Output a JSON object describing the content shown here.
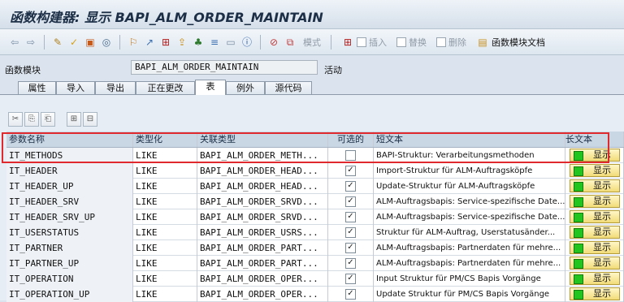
{
  "window": {
    "title": "函数构建器: 显示 BAPI_ALM_ORDER_MAINTAIN"
  },
  "toolbar": {
    "icons": [
      "back-icon",
      "forward-icon",
      "edit-toggle-icon",
      "check-icon",
      "activate-icon",
      "test-icon",
      "where-used-icon",
      "pattern-icon",
      "hierarchy-icon",
      "other-object-icon",
      "display-object-list-icon",
      "navigate-icon",
      "window-icon",
      "info-icon",
      "stop-icon",
      "copy-icon"
    ],
    "mode_label": "模式",
    "insert_label": "插入",
    "replace_label": "替换",
    "delete_label": "删除",
    "docs_label": "函数模块文档"
  },
  "form": {
    "module_label": "函数模块",
    "module_value": "BAPI_ALM_ORDER_MAINTAIN",
    "status": "活动"
  },
  "tabs": [
    "属性",
    "导入",
    "导出",
    "正在更改",
    "表",
    "例外",
    "源代码"
  ],
  "active_tab": "表",
  "grid": {
    "headers": {
      "param": "参数名称",
      "type": "类型化",
      "ref": "关联类型",
      "optional": "可选的",
      "short_text": "短文本",
      "long_text": "长文本"
    },
    "show_label": "显示",
    "rows": [
      {
        "param": "IT_METHODS",
        "type": "LIKE",
        "ref": "BAPI_ALM_ORDER_METH...",
        "optional": false,
        "short_text": "BAPI-Struktur: Verarbeitungsmethoden"
      },
      {
        "param": "IT_HEADER",
        "type": "LIKE",
        "ref": "BAPI_ALM_ORDER_HEAD...",
        "optional": true,
        "short_text": "Import-Struktur für ALM-Auftragsköpfe"
      },
      {
        "param": "IT_HEADER_UP",
        "type": "LIKE",
        "ref": "BAPI_ALM_ORDER_HEAD...",
        "optional": true,
        "short_text": "Update-Struktur für ALM-Auftragsköpfe"
      },
      {
        "param": "IT_HEADER_SRV",
        "type": "LIKE",
        "ref": "BAPI_ALM_ORDER_SRVD...",
        "optional": true,
        "short_text": "ALM-Auftragsbapis: Service-spezifische Date..."
      },
      {
        "param": "IT_HEADER_SRV_UP",
        "type": "LIKE",
        "ref": "BAPI_ALM_ORDER_SRVD...",
        "optional": true,
        "short_text": "ALM-Auftragsbapis: Service-spezifische Date..."
      },
      {
        "param": "IT_USERSTATUS",
        "type": "LIKE",
        "ref": "BAPI_ALM_ORDER_USRS...",
        "optional": true,
        "short_text": "Struktur für ALM-Auftrag, Userstatusänder..."
      },
      {
        "param": "IT_PARTNER",
        "type": "LIKE",
        "ref": "BAPI_ALM_ORDER_PART...",
        "optional": true,
        "short_text": "ALM-Auftragsbapis: Partnerdaten für mehre..."
      },
      {
        "param": "IT_PARTNER_UP",
        "type": "LIKE",
        "ref": "BAPI_ALM_ORDER_PART...",
        "optional": true,
        "short_text": "ALM-Auftragsbapis: Partnerdaten für mehre..."
      },
      {
        "param": "IT_OPERATION",
        "type": "LIKE",
        "ref": "BAPI_ALM_ORDER_OPER...",
        "optional": true,
        "short_text": "Input Struktur für PM/CS Bapis Vorgänge"
      },
      {
        "param": "IT_OPERATION_UP",
        "type": "LIKE",
        "ref": "BAPI_ALM_ORDER_OPER...",
        "optional": true,
        "short_text": "Update Struktur für PM/CS Bapis Vorgänge"
      }
    ]
  }
}
